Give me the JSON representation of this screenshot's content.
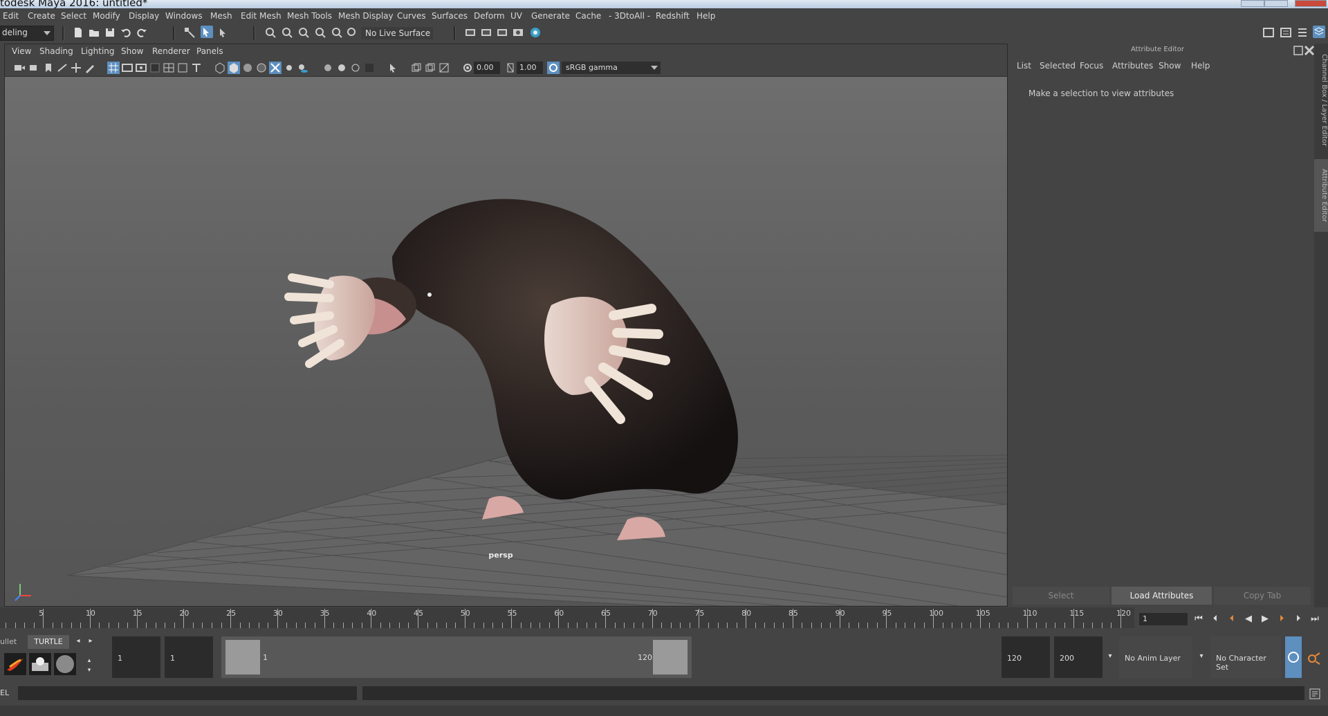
{
  "window": {
    "title": "todesk Maya 2016: untitled*"
  },
  "menubar": [
    "Edit",
    "Create",
    "Select",
    "Modify",
    "Display",
    "Windows",
    "Mesh",
    "Edit Mesh",
    "Mesh Tools",
    "Mesh Display",
    "Curves",
    "Surfaces",
    "Deform",
    "UV",
    "Generate",
    "Cache",
    "- 3DtoAll -",
    "Redshift",
    "Help"
  ],
  "shelf": {
    "mode": "deling",
    "live_surface": "No Live Surface"
  },
  "viewport": {
    "menu": [
      "View",
      "Shading",
      "Lighting",
      "Show",
      "Renderer",
      "Panels"
    ],
    "exposure": "0.00",
    "gamma": "1.00",
    "color_space": "sRGB gamma",
    "camera_label": "persp",
    "axis": {
      "x": "x",
      "y": "y",
      "z": "z"
    }
  },
  "attribute_editor": {
    "title": "Attribute Editor",
    "menu": [
      "List",
      "Selected",
      "Focus",
      "Attributes",
      "Show",
      "Help"
    ],
    "message": "Make a selection to view attributes",
    "buttons": {
      "select": "Select",
      "load": "Load Attributes",
      "copy": "Copy Tab"
    }
  },
  "side_tabs": {
    "channel_box": "Channel Box / Layer Editor",
    "attribute_editor": "Attribute Editor"
  },
  "timeline": {
    "ticks": [
      "5",
      "10",
      "15",
      "20",
      "25",
      "30",
      "35",
      "40",
      "45",
      "50",
      "55",
      "60",
      "65",
      "70",
      "75",
      "80",
      "85",
      "90",
      "95",
      "100",
      "105",
      "110",
      "115",
      "120"
    ],
    "current_frame": "1"
  },
  "range": {
    "start": "1",
    "playback_start": "1",
    "range_start_label": "1",
    "range_end_label": "120",
    "playback_end": "120",
    "end": "200",
    "anim_layer": "No Anim Layer",
    "character_set": "No Character Set"
  },
  "shelf_tabs": {
    "prev": "ullet",
    "active": "TURTLE"
  },
  "command_line": {
    "language": "EL"
  },
  "colors": {
    "bg": "#444444",
    "field": "#2b2b2b",
    "accent": "#5d8fbf",
    "load_button": "#5a5a5a"
  }
}
